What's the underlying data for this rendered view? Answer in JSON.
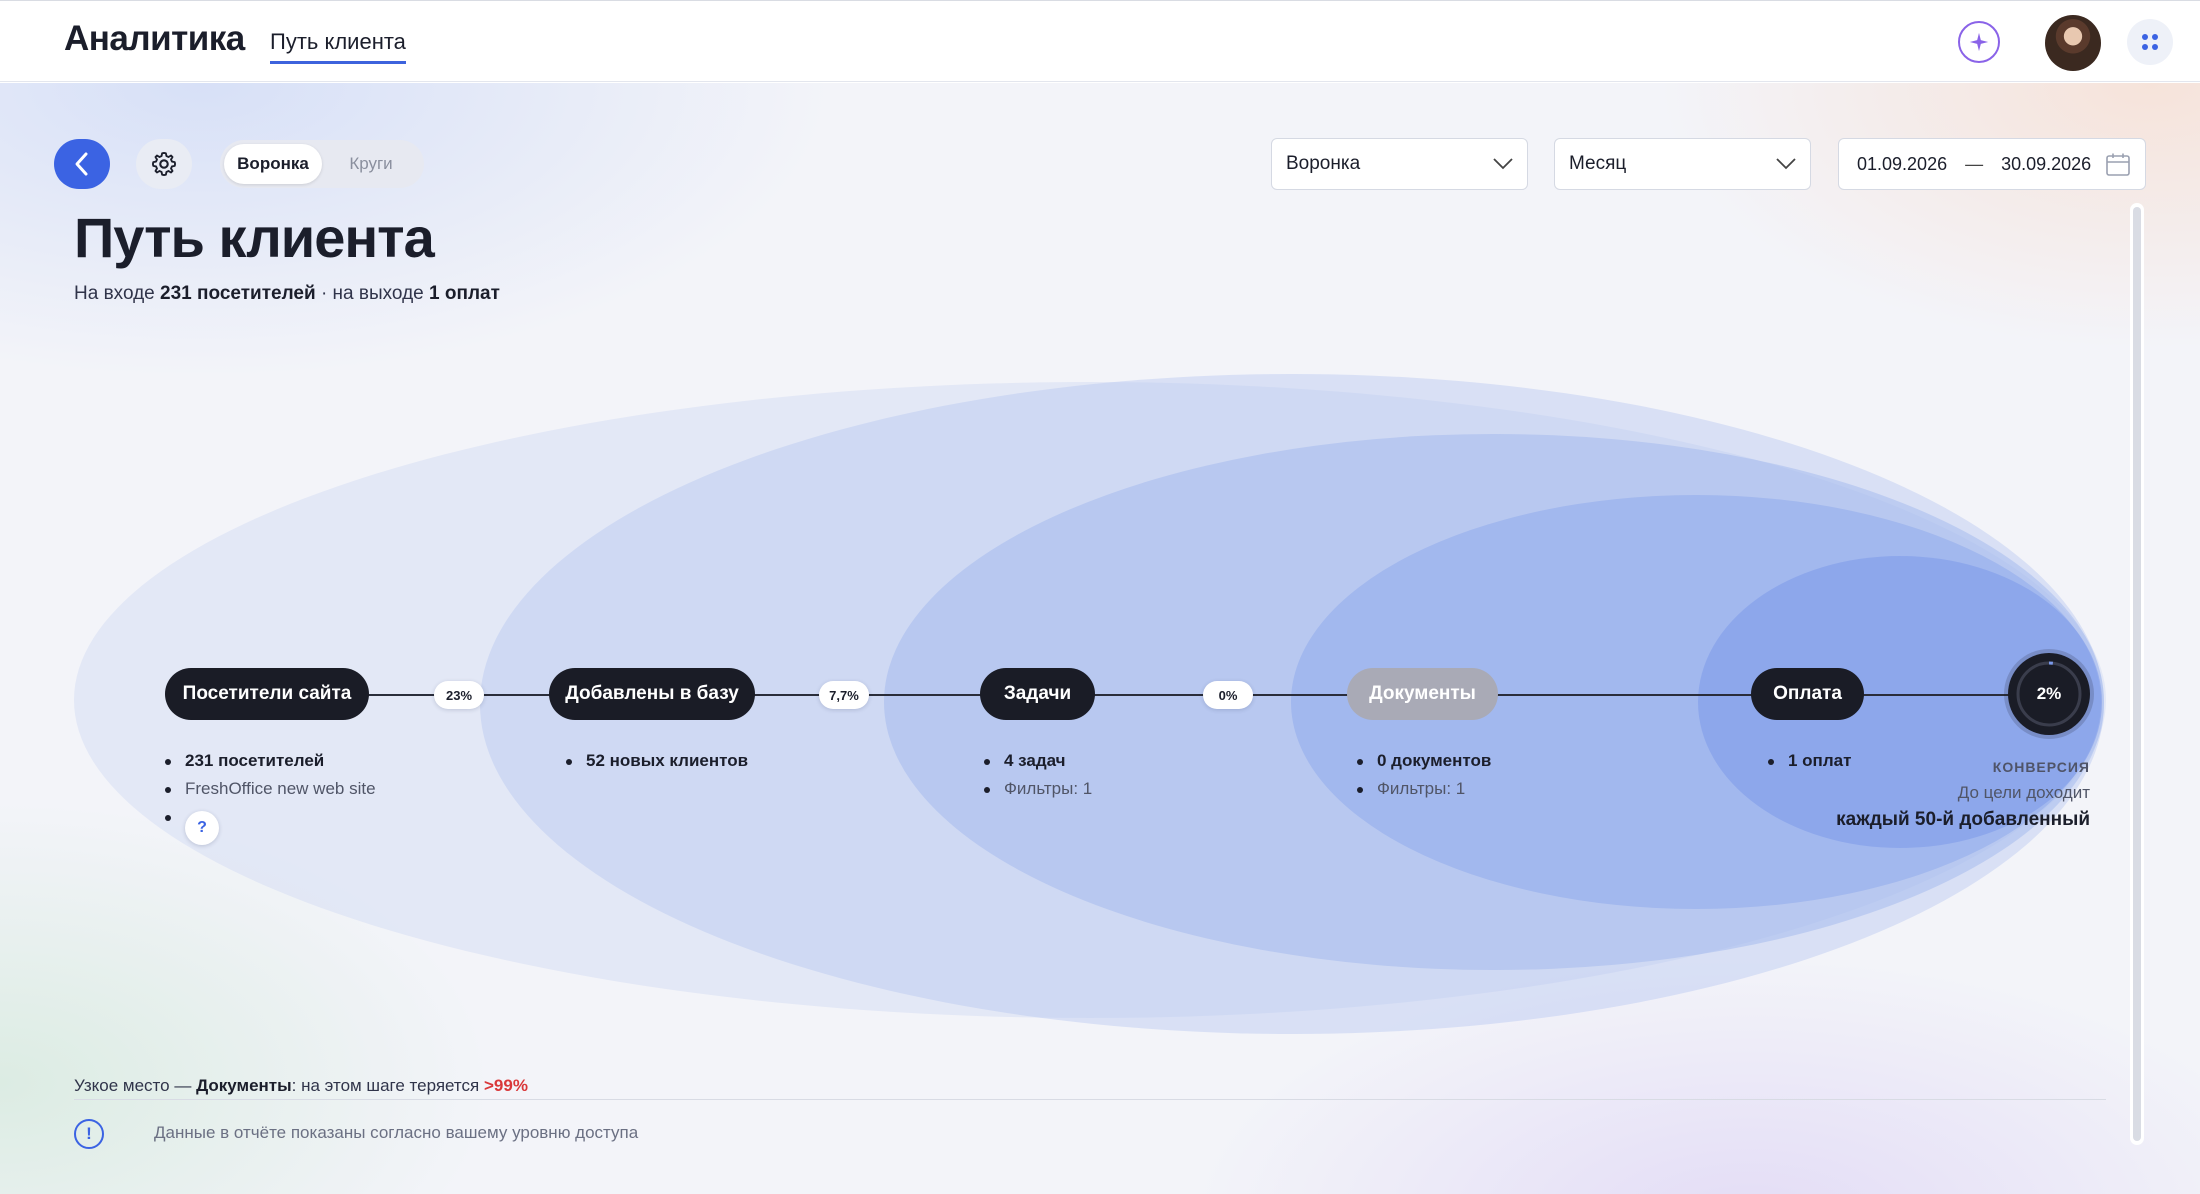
{
  "header": {
    "app_title": "Аналитика",
    "breadcrumb": "Путь клиента"
  },
  "toolbar": {
    "view_toggle": {
      "options": [
        "Воронка",
        "Круги"
      ],
      "selected": "Воронка"
    },
    "mode_select": {
      "value": "Воронка"
    },
    "period_select": {
      "value": "Месяц"
    },
    "date_range": {
      "from": "01.09.2026",
      "separator": "—",
      "to": "30.09.2026"
    }
  },
  "page": {
    "title": "Путь клиента",
    "subtitle": {
      "prefix": "На входе",
      "input_value": "231 посетителей",
      "middle": "· на выходе",
      "output_value": "1 оплат"
    }
  },
  "funnel": {
    "steps": [
      {
        "label": "Посетители сайта",
        "stats": [
          "231 посетителей",
          "FreshOffice new web site"
        ],
        "muted": false
      },
      {
        "label": "Добавлены в базу",
        "stats": [
          "52 новых клиентов"
        ],
        "muted": false
      },
      {
        "label": "Задачи",
        "stats": [
          "4 задач",
          "Фильтры: 1"
        ],
        "muted": false
      },
      {
        "label": "Документы",
        "stats": [
          "0 документов",
          "Фильтры: 1"
        ],
        "muted": true
      },
      {
        "label": "Оплата",
        "stats": [
          "1 оплат"
        ],
        "muted": false
      }
    ],
    "step_conversions": [
      "23%",
      "7,7%",
      "0%"
    ],
    "help_label": "?",
    "conversion": {
      "value": "2%",
      "fraction": 0.02,
      "label": "КОНВЕРСИЯ",
      "sub": "До цели доходит",
      "strong": "каждый 50-й добавленный"
    }
  },
  "footer": {
    "bottleneck": {
      "prefix": "Узкое место —",
      "step": "Документы",
      "middle": ": на этом шаге теряется",
      "loss": ">99%"
    },
    "info_text": "Данные в отчёте показаны согласно вашему уровню доступа"
  },
  "colors": {
    "accent": "#3b63e3",
    "pill_dark": "#1a1c26",
    "pill_muted": "#a9aab6",
    "loss_red": "#d9383a",
    "ellipse_fill": "#6f8fe8"
  }
}
